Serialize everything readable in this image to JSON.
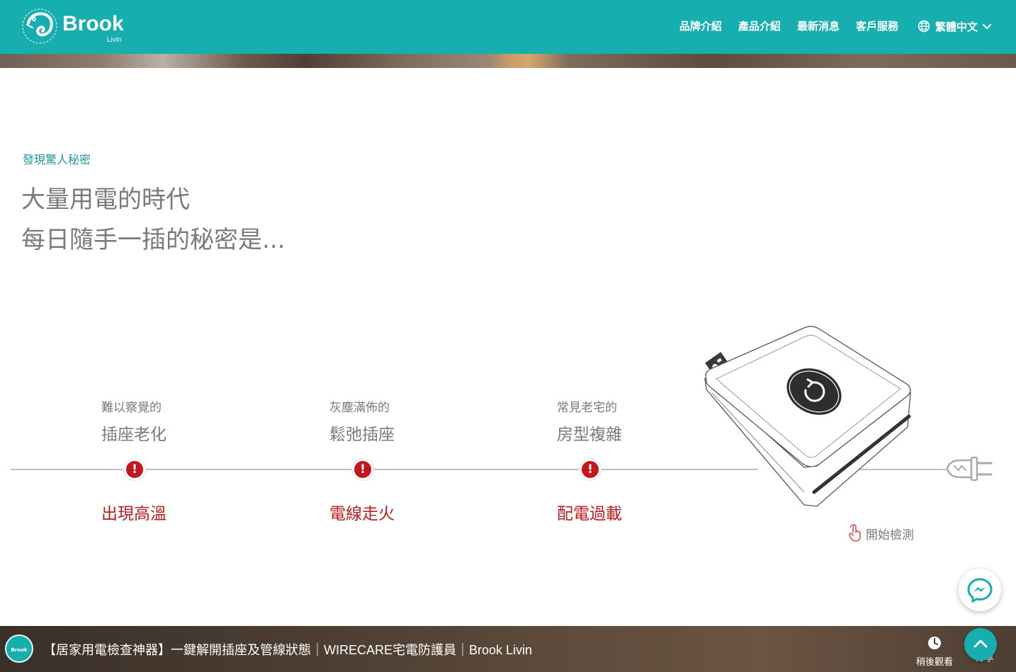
{
  "header": {
    "logo_text": "Brook",
    "logo_sub": "Livin",
    "nav": [
      "品牌介紹",
      "產品介紹",
      "最新消息",
      "客戶服務"
    ],
    "language": "繁體中文",
    "bg_color": "#16aeae"
  },
  "intro": {
    "eyebrow": "發現驚人秘密",
    "headline_line1": "大量用電的時代",
    "headline_line2": "每日隨手一插的秘密是..."
  },
  "timeline": [
    {
      "sub": "難以察覺的",
      "main": "插座老化",
      "alert": "出現高溫"
    },
    {
      "sub": "灰塵滿佈的",
      "main": "鬆弛插座",
      "alert": "電線走火"
    },
    {
      "sub": "常見老宅的",
      "main": "房型複雜",
      "alert": "配電過載"
    }
  ],
  "alert_icon": "!",
  "start_label": "開始檢測",
  "video": {
    "channel": "Brook",
    "title": "【居家用電檢查神器】一鍵解開插座及管線狀態｜WIRECARE宅電防護員｜Brook Livin",
    "watch_later": "稍後觀看",
    "share": "分享"
  },
  "colors": {
    "accent": "#16aeae",
    "alert": "#c4161c"
  }
}
